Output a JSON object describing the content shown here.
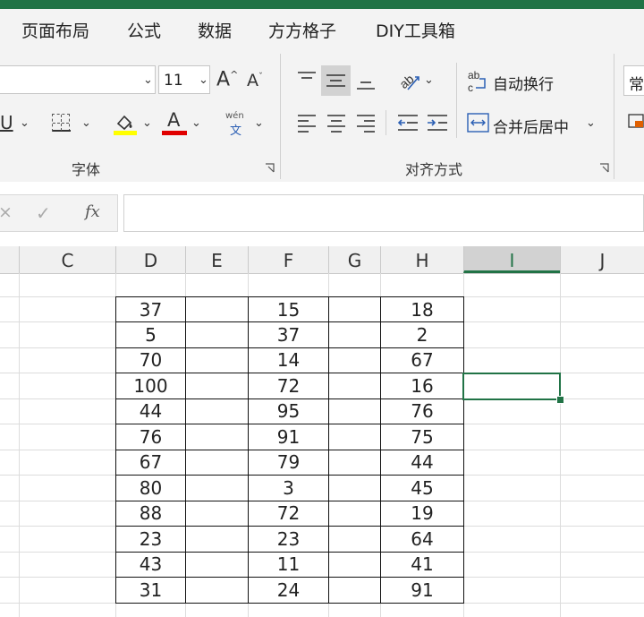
{
  "menu": {
    "tabs": [
      "页面布局",
      "公式",
      "数据",
      "方方格子",
      "DIY工具箱"
    ]
  },
  "ribbon": {
    "font_size": "11",
    "grow_font": "A",
    "shrink_font": "A",
    "underline": "U",
    "font_color_glyph": "A",
    "phonetic_top": "wén",
    "phonetic_bottom": "文",
    "wrap_text": "自动换行",
    "merge_center": "合并后居中",
    "format_partial": "常",
    "group_font": "字体",
    "group_alignment": "对齐方式",
    "fill_color": "#ffff00",
    "font_color": "#ff0000"
  },
  "formula_bar": {
    "cancel": "×",
    "confirm": "✓",
    "fx": "fx",
    "value": ""
  },
  "columns": [
    "C",
    "D",
    "E",
    "F",
    "G",
    "H",
    "I",
    "J"
  ],
  "selected_column": "I",
  "table": {
    "D": [
      "37",
      "5",
      "70",
      "100",
      "44",
      "76",
      "67",
      "80",
      "88",
      "23",
      "43",
      "31"
    ],
    "F": [
      "15",
      "37",
      "14",
      "72",
      "95",
      "91",
      "79",
      "3",
      "72",
      "23",
      "11",
      "24"
    ],
    "H": [
      "18",
      "2",
      "67",
      "16",
      "76",
      "75",
      "44",
      "45",
      "19",
      "64",
      "41",
      "91"
    ]
  },
  "colors": {
    "accent": "#217346"
  }
}
